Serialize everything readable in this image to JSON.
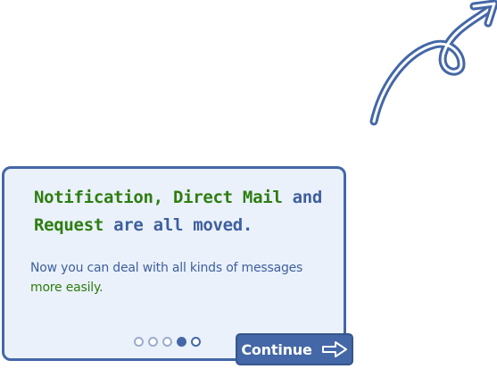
{
  "colors": {
    "accent_blue": "#4467a7",
    "text_blue": "#3f5f9e",
    "text_green": "#2e7d10",
    "panel_bg": "#eaf1fa"
  },
  "decoration": {
    "arrow_icon": "curved-arrow-pointing-up-right"
  },
  "card": {
    "headline": {
      "notification": "Notification,",
      "direct_mail": "Direct Mail",
      "and": "and",
      "request": "Request",
      "rest": "are all moved."
    },
    "body": {
      "line1": "Now you can deal with all kinds of messages",
      "line2": "more easily."
    },
    "pager": {
      "total": 5,
      "current": 4
    }
  },
  "continue_button": {
    "label": "Continue",
    "icon": "arrow-right-icon"
  }
}
